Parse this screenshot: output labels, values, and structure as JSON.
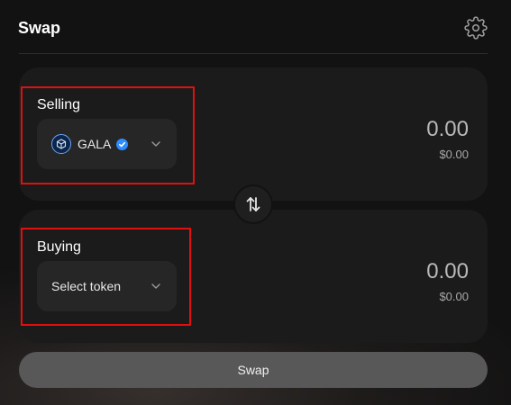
{
  "header": {
    "title": "Swap",
    "settings_icon": "gear-icon"
  },
  "selling": {
    "label": "Selling",
    "token": {
      "symbol": "GALA",
      "icon": "gala-token-icon",
      "verified": true
    },
    "amount": "0.00",
    "usd_value": "$0.00"
  },
  "buying": {
    "label": "Buying",
    "token_placeholder": "Select token",
    "amount": "0.00",
    "usd_value": "$0.00"
  },
  "switch_icon": "swap-direction-icon",
  "actions": {
    "swap_label": "Swap"
  },
  "colors": {
    "background": "#121212",
    "panel": "#1b1b1b",
    "verified": "#2d8cff",
    "highlight": "#e01010"
  }
}
